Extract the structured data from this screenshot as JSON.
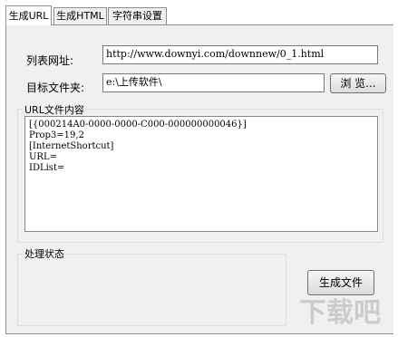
{
  "tabs": [
    "生成URL",
    "生成HTML",
    "字符串设置"
  ],
  "form": {
    "list_url_label": "列表网址:",
    "list_url_value": "http://www.downyi.com/downnew/0_1.html",
    "target_folder_label": "目标文件夹:",
    "target_folder_value": "e:\\上传软件\\",
    "browse_button": "浏 览..."
  },
  "url_content": {
    "legend": "URL文件内容",
    "lines": [
      "[{000214A0-0000-0000-C000-000000000046}]",
      "Prop3=19,2",
      "[InternetShortcut]",
      "URL=",
      "IDList="
    ]
  },
  "status": {
    "legend": "处理状态"
  },
  "generate_button": "生成文件",
  "watermark": "下载吧"
}
